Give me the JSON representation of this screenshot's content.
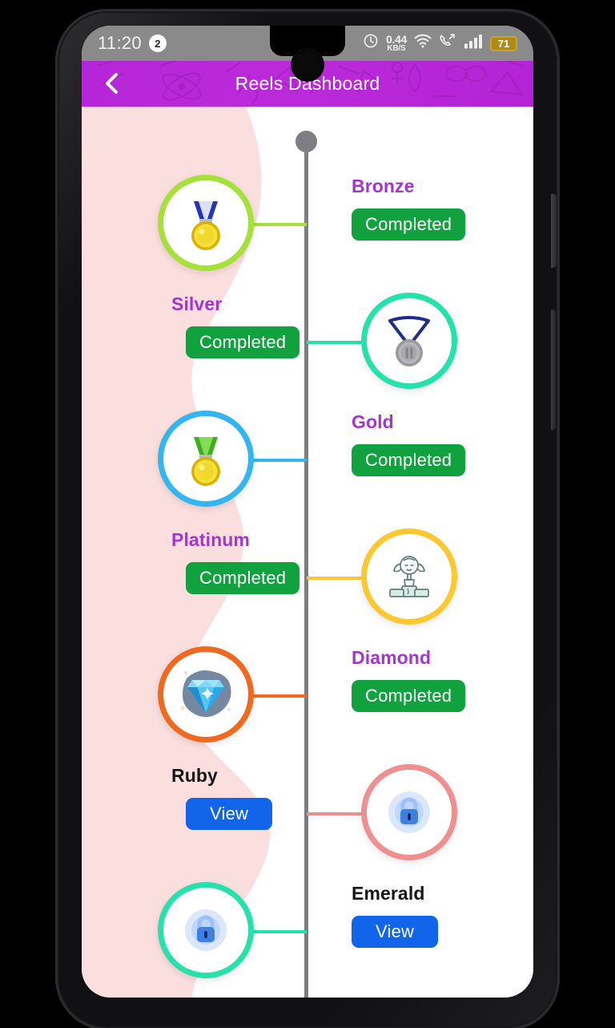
{
  "statusbar": {
    "time": "11:20",
    "notification_count": "2",
    "network_speed_value": "0.44",
    "network_speed_unit": "KB/S",
    "battery_level": "71",
    "icons": [
      "alarm-clock-icon",
      "wifi-icon",
      "call-forward-icon",
      "cellular-signal-icon",
      "battery-icon"
    ]
  },
  "appbar": {
    "title": "Reels Dashboard",
    "back_icon": "chevron-left-icon",
    "background_color": "#b324d6"
  },
  "theme": {
    "accent_purple": "#a435cf",
    "completed_green": "#12a13f",
    "view_blue": "#1264e8",
    "timeline_gray": "#7e7e82",
    "blob_pink": "#fbdede",
    "locked_label": "#161616"
  },
  "timeline": {
    "top_dot": true,
    "tiers": [
      {
        "name": "Bronze",
        "status_label": "Completed",
        "status_type": "completed",
        "icon": "bronze-medal-icon",
        "ring_color": "#a6e03a",
        "side": "left",
        "text_side": "right"
      },
      {
        "name": "Silver",
        "status_label": "Completed",
        "status_type": "completed",
        "icon": "silver-medal-icon",
        "ring_color": "#26e2aa",
        "side": "right",
        "text_side": "left"
      },
      {
        "name": "Gold",
        "status_label": "Completed",
        "status_type": "completed",
        "icon": "gold-medal-icon",
        "ring_color": "#33b5ef",
        "side": "left",
        "text_side": "right"
      },
      {
        "name": "Platinum",
        "status_label": "Completed",
        "status_type": "completed",
        "icon": "trophy-podium-icon",
        "ring_color": "#fbc831",
        "side": "right",
        "text_side": "left"
      },
      {
        "name": "Diamond",
        "status_label": "Completed",
        "status_type": "completed",
        "icon": "diamond-gem-icon",
        "ring_color": "#ee6a21",
        "side": "left",
        "text_side": "right"
      },
      {
        "name": "Ruby",
        "status_label": "View",
        "status_type": "locked",
        "icon": "padlock-icon",
        "ring_color": "#ef8f8f",
        "side": "right",
        "text_side": "left"
      },
      {
        "name": "Emerald",
        "status_label": "View",
        "status_type": "locked",
        "icon": "padlock-icon",
        "ring_color": "#26e2aa",
        "side": "left",
        "text_side": "right"
      }
    ]
  }
}
